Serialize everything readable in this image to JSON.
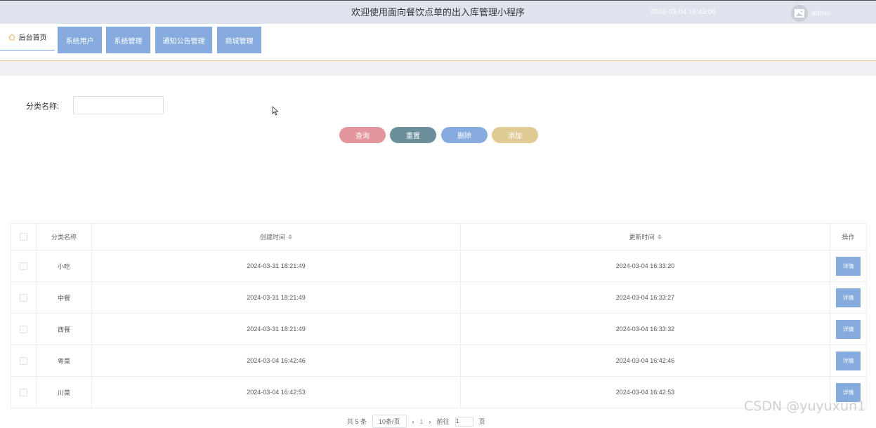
{
  "header": {
    "title": "欢迎使用面向餐饮点单的出入库管理小程序",
    "datetime": "2024-03-04 16:43:06",
    "username": "admin"
  },
  "nav": {
    "home_label": "后台首页",
    "items": [
      {
        "label": "系统用户"
      },
      {
        "label": "系统管理"
      },
      {
        "label": "通知公告管理"
      },
      {
        "label": "商城管理"
      }
    ]
  },
  "search": {
    "label": "分类名称:",
    "value": "",
    "placeholder": ""
  },
  "actions": {
    "query": "查询",
    "reset": "重置",
    "delete": "删除",
    "add": "添加"
  },
  "colors": {
    "query": "#e4969e",
    "reset": "#6a8f9b",
    "delete": "#86acdf",
    "add": "#e0cb94",
    "accent": "#86acdf"
  },
  "table": {
    "headers": {
      "name": "分类名称",
      "created": "创建时间",
      "updated": "更新时间",
      "ops": "操作"
    },
    "detail_label": "详情",
    "rows": [
      {
        "name": "小吃",
        "created": "2024-03-31 18:21:49",
        "updated": "2024-03-04 16:33:20"
      },
      {
        "name": "中餐",
        "created": "2024-03-31 18:21:49",
        "updated": "2024-03-04 16:33:27"
      },
      {
        "name": "西餐",
        "created": "2024-03-31 18:21:49",
        "updated": "2024-03-04 16:33:32"
      },
      {
        "name": "粤菜",
        "created": "2024-03-04 16:42:46",
        "updated": "2024-03-04 16:42:46"
      },
      {
        "name": "川菜",
        "created": "2024-03-04 16:42:53",
        "updated": "2024-03-04 16:42:53"
      }
    ]
  },
  "pagination": {
    "total": "共 5 条",
    "page_size": "10条/页",
    "current": "1",
    "goto": "前往",
    "goto_value": "1",
    "page_unit": "页"
  },
  "watermark": "CSDN @yuyuxun1"
}
